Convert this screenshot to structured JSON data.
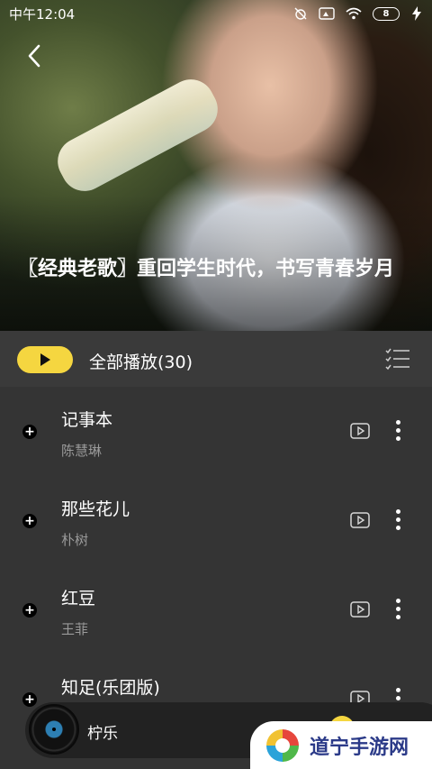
{
  "status_bar": {
    "time": "中午12:04",
    "battery": "8"
  },
  "header": {
    "title": "〖经典老歌〗重回学生时代，书写青春岁月"
  },
  "controls": {
    "play_all_label": "全部播放(30)"
  },
  "songs": [
    {
      "title": "记事本",
      "artist": "陈慧琳"
    },
    {
      "title": "那些花儿",
      "artist": "朴树"
    },
    {
      "title": "红豆",
      "artist": "王菲"
    },
    {
      "title": "知足(乐团版)",
      "artist": ""
    }
  ],
  "mini_player": {
    "title": "柠乐"
  },
  "watermark": {
    "text": "道宁手游网"
  },
  "colors": {
    "accent": "#f5d640",
    "background": "#343434"
  }
}
